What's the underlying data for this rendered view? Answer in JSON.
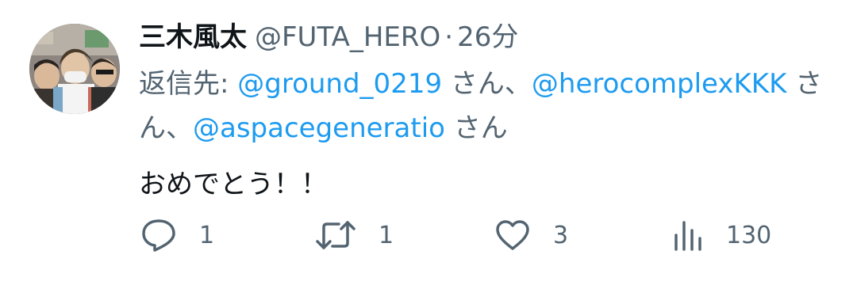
{
  "tweet": {
    "display_name": "三木風太",
    "handle": "@FUTA_HERO",
    "separator": "·",
    "time": "26分",
    "reply_to": {
      "prefix": "返信先: ",
      "mentions": [
        {
          "handle": "@ground_0219",
          "suffix": "さん、"
        },
        {
          "handle": "@herocomplexKKK",
          "suffix": "さん、"
        },
        {
          "handle": "@aspacegeneratio",
          "suffix": "さん"
        }
      ]
    },
    "text": "おめでとう！！"
  },
  "actions": {
    "reply": {
      "icon": "reply-icon",
      "count": "1"
    },
    "retweet": {
      "icon": "retweet-icon",
      "count": "1"
    },
    "like": {
      "icon": "heart-icon",
      "count": "3"
    },
    "views": {
      "icon": "views-icon",
      "count": "130"
    }
  },
  "colors": {
    "mention": "#1d9bf0",
    "secondary": "#536471",
    "primary": "#0f1419"
  }
}
